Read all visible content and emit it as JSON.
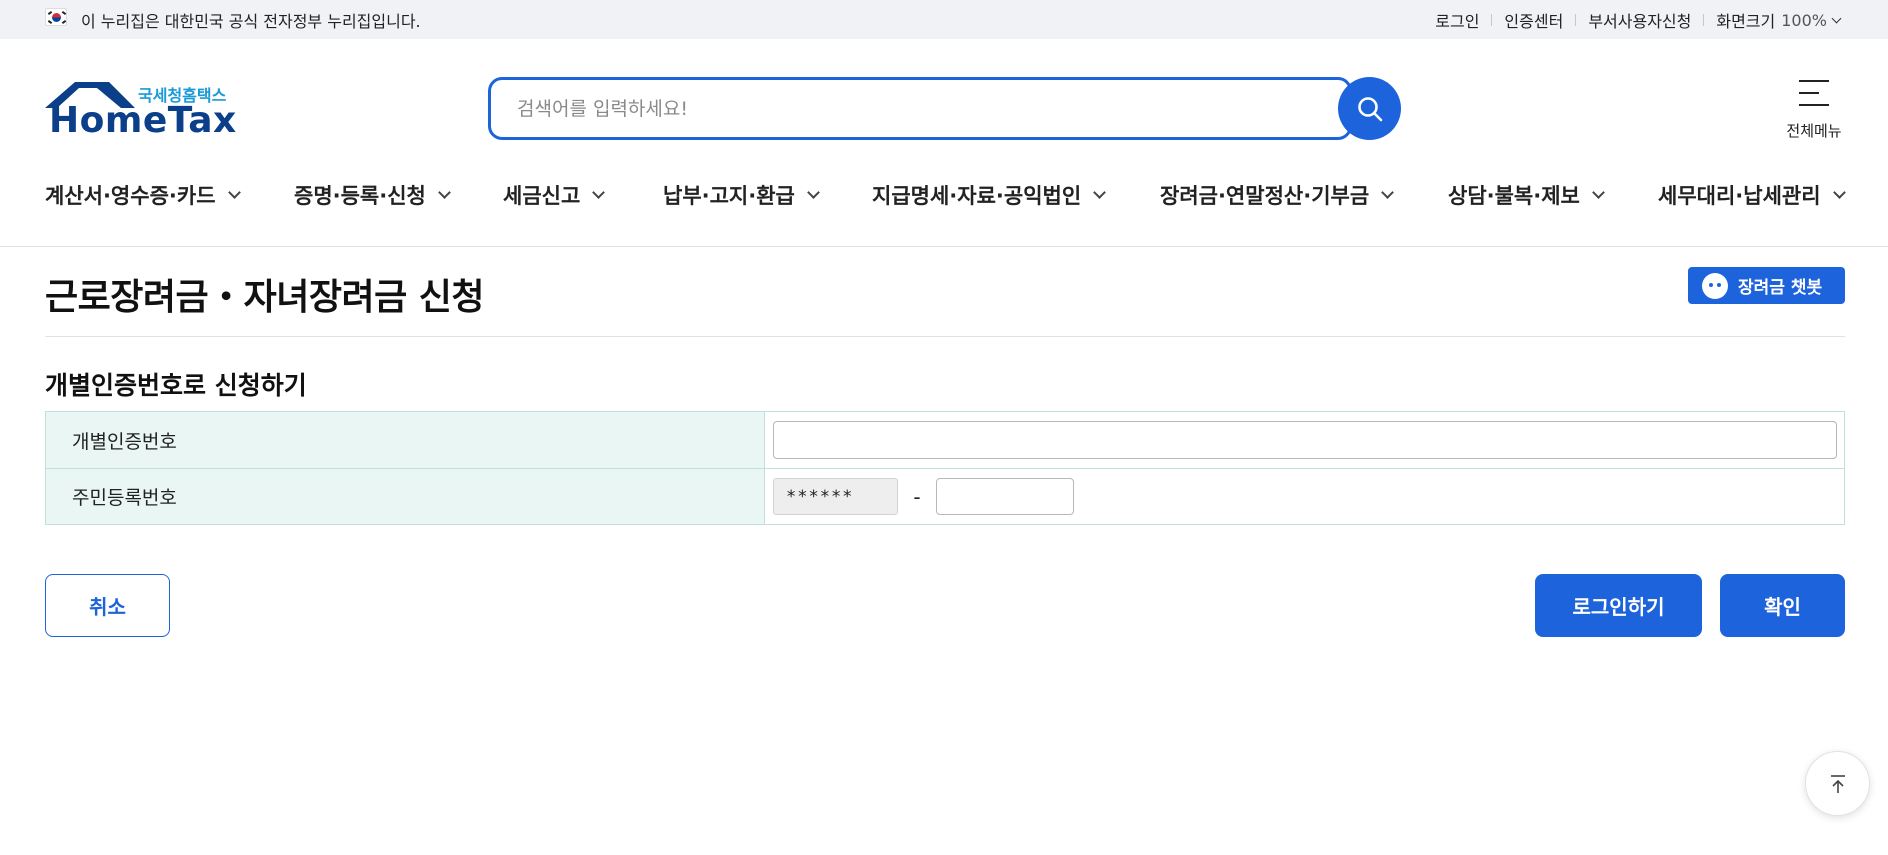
{
  "gov_banner": {
    "text": "이 누리집은 대한민국 공식 전자정부 누리집입니다.",
    "flag_icon": "korean-flag-icon"
  },
  "utility_links": {
    "login": "로그인",
    "cert_center": "인증센터",
    "dept_user": "부서사용자신청",
    "zoom_label": "화면크기",
    "zoom_value": "100%"
  },
  "logo": {
    "brand_ko": "국세청홈택스",
    "brand_en": "HomeTax"
  },
  "search": {
    "placeholder": "검색어를 입력하세요!",
    "value": ""
  },
  "all_menu": {
    "label": "전체메뉴"
  },
  "gnb": {
    "items": [
      {
        "label": "계산서·영수증·카드"
      },
      {
        "label": "증명·등록·신청"
      },
      {
        "label": "세금신고"
      },
      {
        "label": "납부·고지·환급"
      },
      {
        "label": "지급명세·자료·공익법인"
      },
      {
        "label": "장려금·연말정산·기부금"
      },
      {
        "label": "상담·불복·제보"
      },
      {
        "label": "세무대리·납세관리"
      }
    ]
  },
  "page": {
    "title": "근로장려금・자녀장려금 신청",
    "chatbot_label": "장려금 챗봇"
  },
  "section": {
    "title": "개별인증번호로 신청하기"
  },
  "form": {
    "cert_number_label": "개별인증번호",
    "cert_number_value": "",
    "rrn_label": "주민등록번호",
    "rrn_front_value": "******",
    "rrn_dash": "-",
    "rrn_back_value": ""
  },
  "buttons": {
    "cancel": "취소",
    "login": "로그인하기",
    "confirm": "확인"
  },
  "colors": {
    "primary": "#1d63dc",
    "label_bg": "#eaf6f4",
    "table_border": "#bfe0dc",
    "gov_bar_bg": "#f0f2f6",
    "logo_navy": "#0b3f8a",
    "logo_cyan": "#1a9ad6"
  }
}
